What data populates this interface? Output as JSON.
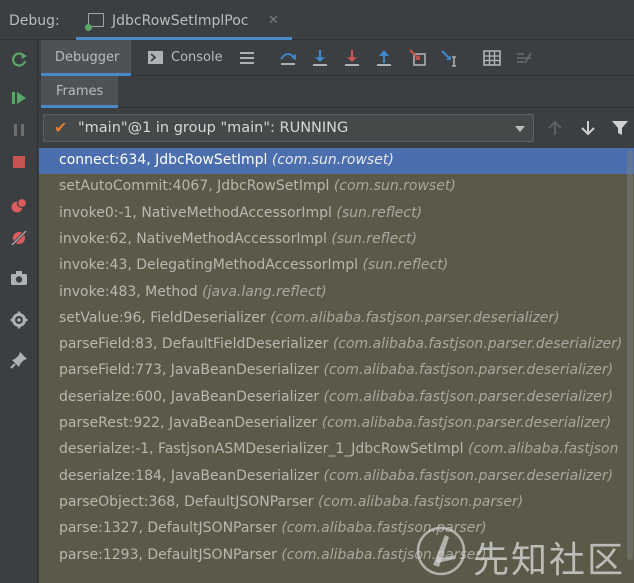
{
  "header": {
    "debug_label": "Debug:",
    "run_tab_title": "JdbcRowSetImplPoc",
    "close_glyph": "✕"
  },
  "left_toolbar": [
    {
      "icon": "rerun-icon"
    },
    {
      "icon": "resume-icon"
    },
    {
      "icon": "pause-icon"
    },
    {
      "icon": "stop-icon"
    },
    {
      "icon": "view-breakpoints-icon"
    },
    {
      "icon": "mute-breakpoints-icon"
    },
    {
      "icon": "camera-icon"
    },
    {
      "icon": "settings-icon"
    },
    {
      "icon": "pin-icon"
    }
  ],
  "subtabs": {
    "debugger_label": "Debugger",
    "console_label": "Console"
  },
  "toolbar_icons": [
    "show-execution-point-icon",
    "step-over-icon",
    "step-into-icon",
    "step-out-icon",
    "drop-frame-icon",
    "run-to-cursor-icon",
    "evaluate-icon",
    "trace-icon"
  ],
  "frames_panel": {
    "tab_label": "Frames",
    "thread_check": "✔",
    "thread_text": "\"main\"@1 in group \"main\": RUNNING"
  },
  "frames": [
    {
      "method": "connect:634, JdbcRowSetImpl",
      "pkg": "(com.sun.rowset)"
    },
    {
      "method": "setAutoCommit:4067, JdbcRowSetImpl",
      "pkg": "(com.sun.rowset)"
    },
    {
      "method": "invoke0:-1, NativeMethodAccessorImpl",
      "pkg": "(sun.reflect)"
    },
    {
      "method": "invoke:62, NativeMethodAccessorImpl",
      "pkg": "(sun.reflect)"
    },
    {
      "method": "invoke:43, DelegatingMethodAccessorImpl",
      "pkg": "(sun.reflect)"
    },
    {
      "method": "invoke:483, Method",
      "pkg": "(java.lang.reflect)"
    },
    {
      "method": "setValue:96, FieldDeserializer",
      "pkg": "(com.alibaba.fastjson.parser.deserializer)"
    },
    {
      "method": "parseField:83, DefaultFieldDeserializer",
      "pkg": "(com.alibaba.fastjson.parser.deserializer)"
    },
    {
      "method": "parseField:773, JavaBeanDeserializer",
      "pkg": "(com.alibaba.fastjson.parser.deserializer)"
    },
    {
      "method": "deserialze:600, JavaBeanDeserializer",
      "pkg": "(com.alibaba.fastjson.parser.deserializer)"
    },
    {
      "method": "parseRest:922, JavaBeanDeserializer",
      "pkg": "(com.alibaba.fastjson.parser.deserializer)"
    },
    {
      "method": "deserialze:-1, FastjsonASMDeserializer_1_JdbcRowSetImpl",
      "pkg": "(com.alibaba.fastjson"
    },
    {
      "method": "deserialze:184, JavaBeanDeserializer",
      "pkg": "(com.alibaba.fastjson.parser.deserializer)"
    },
    {
      "method": "parseObject:368, DefaultJSONParser",
      "pkg": "(com.alibaba.fastjson.parser)"
    },
    {
      "method": "parse:1327, DefaultJSONParser",
      "pkg": "(com.alibaba.fastjson.parser)"
    },
    {
      "method": "parse:1293, DefaultJSONParser",
      "pkg": "(com.alibaba.fastjson.parser)"
    },
    {
      "method": "",
      "pkg": ""
    }
  ],
  "selected_frame_index": 0,
  "watermark": {
    "text": "先知社区"
  },
  "colors": {
    "accent": "#4a88c7",
    "selected_row": "#4b6eaf",
    "list_bg": "#5b5a49",
    "panel_bg": "#3c3f41"
  }
}
